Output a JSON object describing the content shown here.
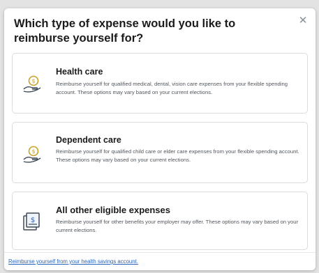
{
  "modal": {
    "title": "Which type of expense would you like to reimburse yourself for?",
    "close_icon": "close-icon"
  },
  "options": [
    {
      "title": "Health care",
      "description": "Reimburse yourself for qualified medical, dental, vision care expenses from your flexible spending account. These options may vary based on your current elections.",
      "icon": "hand-coin-icon"
    },
    {
      "title": "Dependent care",
      "description": "Reimburse yourself for qualified child care or elder care expenses from your flexible spending account. These options may vary based on your current elections.",
      "icon": "hand-coin-icon"
    },
    {
      "title": "All other eligible expenses",
      "description": "Reimburse yourself for other benefits your employer may offer. These options may vary based on your current elections.",
      "icon": "document-dollar-icon"
    }
  ],
  "footer": {
    "link_text": "Reimburse yourself from your health savings account."
  },
  "colors": {
    "accent_icon": "#c9a227",
    "icon_outline": "#3d4854",
    "link": "#2b64b8"
  }
}
